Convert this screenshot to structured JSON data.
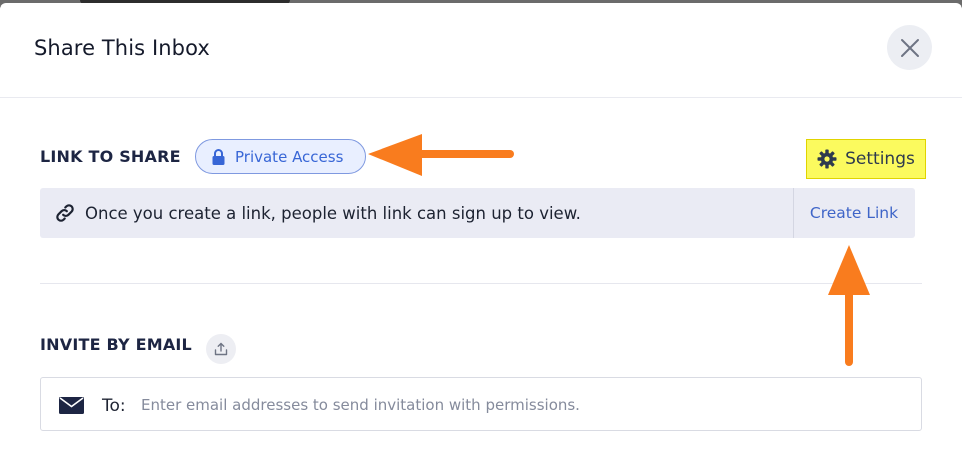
{
  "modal": {
    "title": "Share This Inbox"
  },
  "link_section": {
    "label": "LINK TO SHARE",
    "access_badge": "Private Access",
    "settings_label": "Settings",
    "info_text": "Once you create a link, people with link can sign up to view.",
    "create_link_label": "Create Link"
  },
  "invite_section": {
    "label": "INVITE BY EMAIL",
    "to_label": "To:",
    "email_value": "",
    "email_placeholder": "Enter email addresses to send invitation with permissions."
  },
  "icons": {
    "close": "close-icon",
    "lock": "lock-icon",
    "gear": "gear-icon",
    "link": "link-icon",
    "upload": "upload-icon",
    "mail": "mail-icon"
  },
  "colors": {
    "accent": "#3866d6",
    "settings_highlight": "#fbfa5e",
    "annotation_arrow": "#f97c1e"
  }
}
